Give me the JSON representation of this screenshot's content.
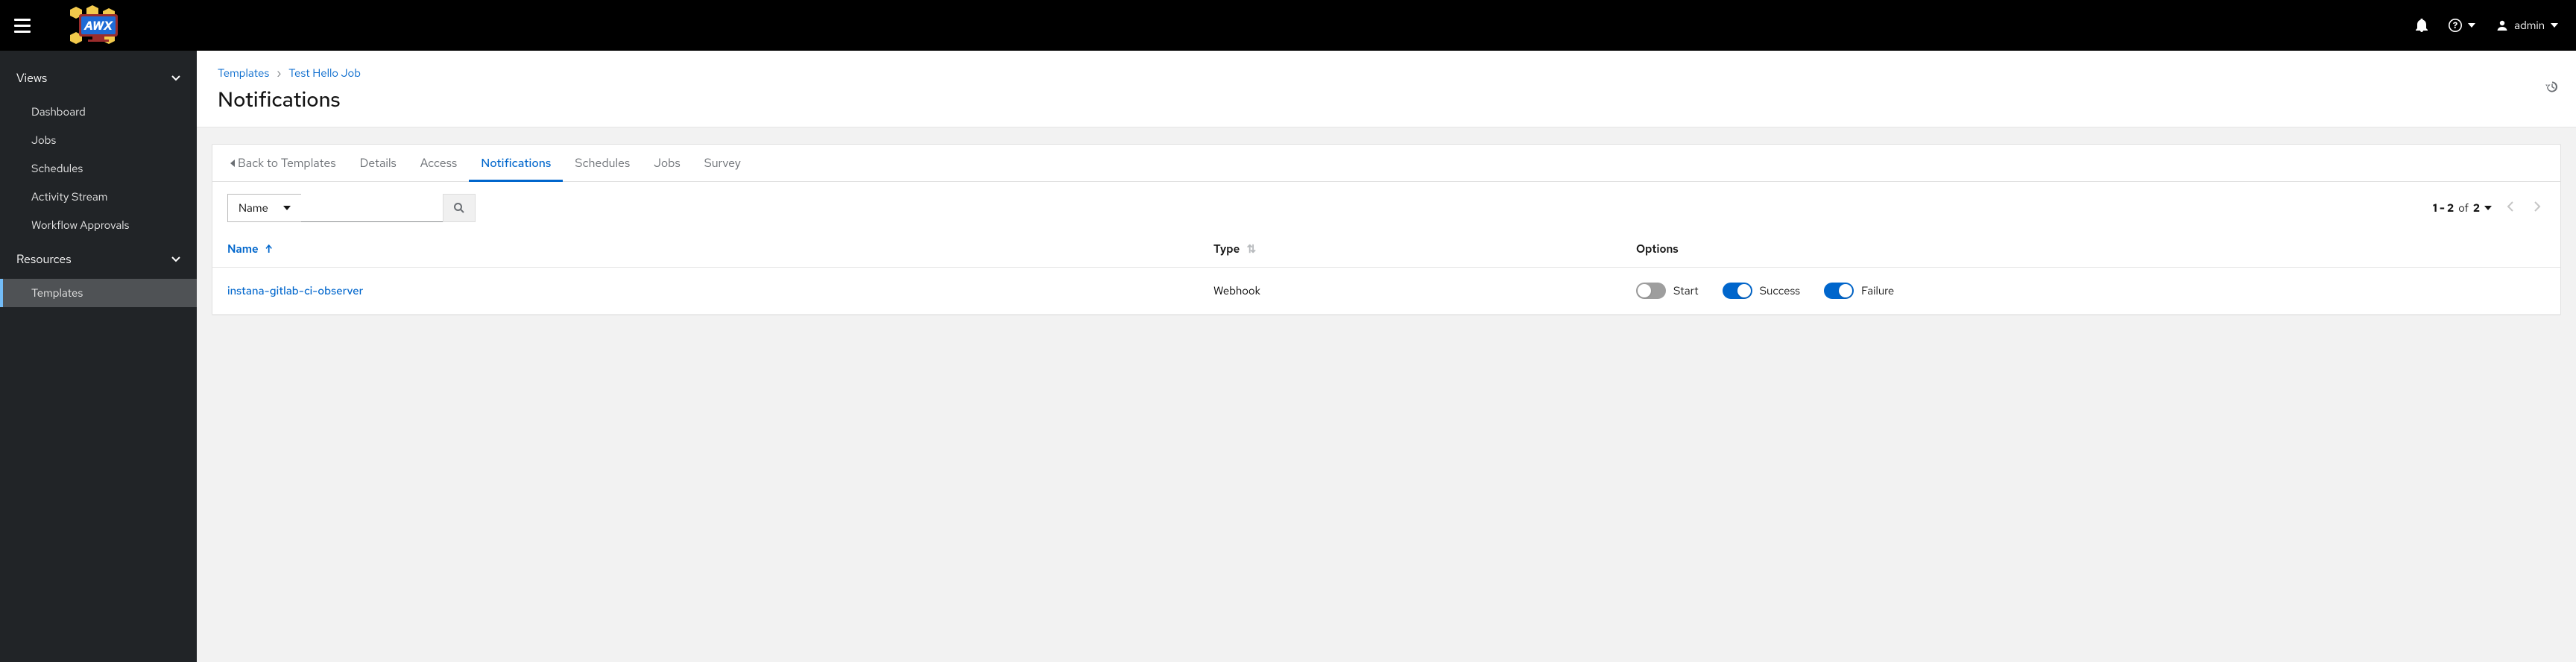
{
  "header": {
    "user_label": "admin"
  },
  "sidebar": {
    "groups": [
      {
        "label": "Views",
        "items": [
          {
            "label": "Dashboard"
          },
          {
            "label": "Jobs"
          },
          {
            "label": "Schedules"
          },
          {
            "label": "Activity Stream"
          },
          {
            "label": "Workflow Approvals"
          }
        ]
      },
      {
        "label": "Resources",
        "items": [
          {
            "label": "Templates",
            "active": true
          }
        ]
      }
    ]
  },
  "breadcrumbs": {
    "root": "Templates",
    "current": "Test Hello Job"
  },
  "page_title": "Notifications",
  "tabs": {
    "back": "Back to Templates",
    "items": [
      {
        "label": "Details"
      },
      {
        "label": "Access"
      },
      {
        "label": "Notifications",
        "active": true
      },
      {
        "label": "Schedules"
      },
      {
        "label": "Jobs"
      },
      {
        "label": "Survey"
      }
    ]
  },
  "filter": {
    "field": "Name",
    "placeholder": ""
  },
  "pager": {
    "range": "1 - 2",
    "of_label": "of",
    "total": "2"
  },
  "table": {
    "columns": {
      "name": "Name",
      "type": "Type",
      "options": "Options"
    },
    "rows": [
      {
        "name": "instana-gitlab-ci-observer",
        "type": "Webhook",
        "options": {
          "start": {
            "label": "Start",
            "on": false
          },
          "success": {
            "label": "Success",
            "on": true
          },
          "failure": {
            "label": "Failure",
            "on": true
          }
        }
      }
    ]
  }
}
